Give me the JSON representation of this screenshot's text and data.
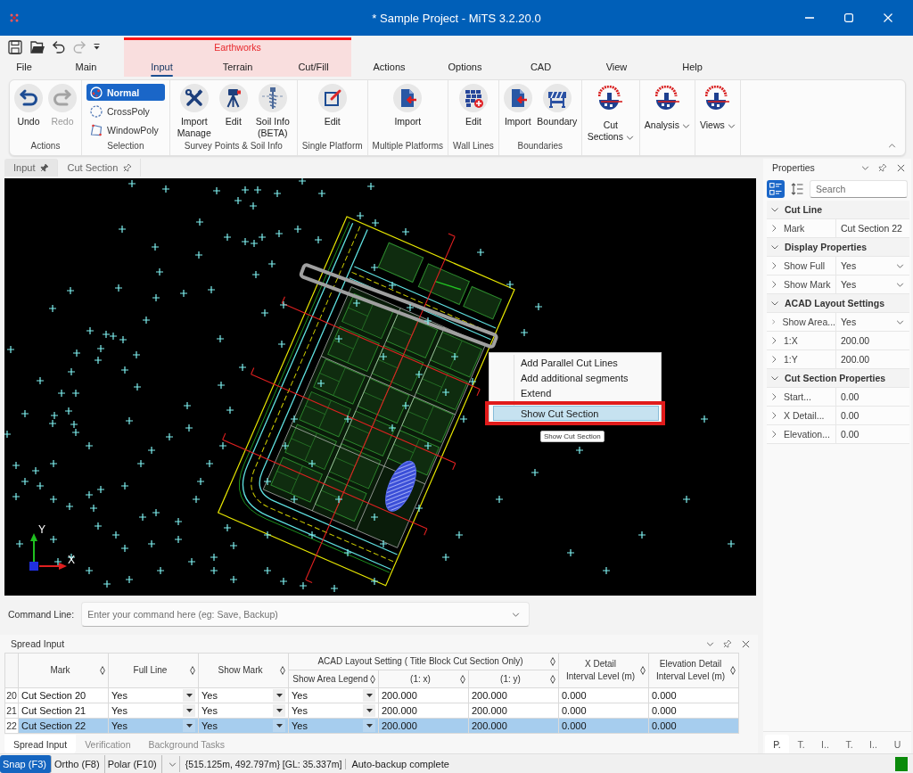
{
  "window": {
    "title": "* Sample Project - MiTS 3.2.20.0"
  },
  "quick_access": [
    {
      "kind": "save",
      "disabled": false
    },
    {
      "kind": "open",
      "disabled": false
    },
    {
      "kind": "undo",
      "disabled": false
    },
    {
      "kind": "redo",
      "disabled": true
    },
    {
      "kind": "customize",
      "disabled": false
    }
  ],
  "ribbon_tabs": [
    {
      "kind": "tab",
      "label": "File",
      "selected": false
    },
    {
      "kind": "tab",
      "label": "Main",
      "selected": false
    },
    {
      "kind": "context_group",
      "label": "Earthworks",
      "tabs": [
        {
          "label": "Input",
          "selected": true
        },
        {
          "label": "Terrain",
          "selected": false
        },
        {
          "label": "Cut/Fill",
          "selected": false
        }
      ]
    },
    {
      "kind": "tab",
      "label": "Actions",
      "selected": false
    },
    {
      "kind": "tab",
      "label": "Options",
      "selected": false
    },
    {
      "kind": "tab",
      "label": "CAD",
      "selected": false
    },
    {
      "kind": "tab",
      "label": "View",
      "selected": false
    },
    {
      "kind": "tab",
      "label": "Help",
      "selected": false
    }
  ],
  "ribbon_groups": [
    {
      "label": "Actions",
      "kind": "large",
      "buttons": [
        {
          "label": "Undo",
          "disabled": false
        },
        {
          "label": "Redo",
          "disabled": true
        }
      ]
    },
    {
      "label": "Selection",
      "kind": "options",
      "buttons": [
        {
          "label": "Normal",
          "selected": true
        },
        {
          "label": "CrossPoly",
          "selected": false
        },
        {
          "label": "WindowPoly",
          "selected": false
        }
      ]
    },
    {
      "label": "Survey Points & Soil Info",
      "kind": "large",
      "buttons": [
        {
          "label": "Import Manage",
          "disabled": false
        },
        {
          "label": "Edit",
          "disabled": false
        },
        {
          "label": "Soil Info (BETA)",
          "disabled": false
        }
      ]
    },
    {
      "label": "Single Platform",
      "kind": "large",
      "buttons": [
        {
          "label": "Edit",
          "disabled": false
        }
      ]
    },
    {
      "label": "Multiple Platforms",
      "kind": "large",
      "buttons": [
        {
          "label": "Import",
          "disabled": false
        }
      ]
    },
    {
      "label": "Wall Lines",
      "kind": "large",
      "buttons": [
        {
          "label": "Edit",
          "disabled": false
        }
      ]
    },
    {
      "label": "Boundaries",
      "kind": "large",
      "buttons": [
        {
          "label": "Import",
          "disabled": false
        },
        {
          "label": "Boundary",
          "disabled": false
        }
      ]
    },
    {
      "kind": "dropdown",
      "buttons": [
        {
          "label": "Cut Sections",
          "disabled": false
        }
      ]
    },
    {
      "kind": "dropdown",
      "buttons": [
        {
          "label": "Analysis",
          "disabled": false
        }
      ]
    },
    {
      "kind": "dropdown",
      "buttons": [
        {
          "label": "Views",
          "disabled": false
        }
      ]
    }
  ],
  "document_tabs": [
    {
      "label": "Input",
      "selected": true,
      "pinned": true
    },
    {
      "label": "Cut Section",
      "selected": false,
      "pinned": false
    }
  ],
  "canvas": {
    "axis": {
      "x_label": "X",
      "y_label": "Y"
    },
    "context_menu": [
      {
        "label": "Add Parallel Cut Lines",
        "selected": false,
        "annotated": false
      },
      {
        "label": "Add additional segments",
        "selected": false,
        "annotated": false
      },
      {
        "label": "Extend",
        "selected": false,
        "annotated": false
      },
      {
        "label": "Show Cut Section",
        "selected": true,
        "annotated": true
      }
    ],
    "tooltip": "Show Cut Section"
  },
  "command_line": {
    "label": "Command Line:",
    "placeholder": "Enter your command here (eg: Save, Backup)"
  },
  "spread_input": {
    "title": "Spread Input",
    "column_group": {
      "label": "ACAD Layout Setting ( Title Block Cut Section Only)"
    },
    "columns": [
      {
        "label": "Mark",
        "kind": "text",
        "grouped": false
      },
      {
        "label": "Full Line",
        "kind": "dropdown",
        "grouped": false
      },
      {
        "label": "Show Mark",
        "kind": "dropdown",
        "grouped": false
      },
      {
        "label": "Show Area Legend",
        "kind": "dropdown",
        "grouped": true
      },
      {
        "label": "(1: x)",
        "kind": "text",
        "grouped": true
      },
      {
        "label": "(1: y)",
        "kind": "text",
        "grouped": true
      },
      {
        "label": "X Detail\nInterval Level (m)",
        "kind": "text",
        "grouped": false
      },
      {
        "label": "Elevation Detail\nInterval Level (m)",
        "kind": "text",
        "grouped": false
      }
    ],
    "rows": [
      {
        "number": "20",
        "selected": false,
        "cells": [
          "Cut Section 20",
          "Yes",
          "Yes",
          "Yes",
          "200.000",
          "200.000",
          "0.000",
          "0.000"
        ]
      },
      {
        "number": "21",
        "selected": false,
        "cells": [
          "Cut Section 21",
          "Yes",
          "Yes",
          "Yes",
          "200.000",
          "200.000",
          "0.000",
          "0.000"
        ]
      },
      {
        "number": "22",
        "selected": true,
        "cells": [
          "Cut Section 22",
          "Yes",
          "Yes",
          "Yes",
          "200.000",
          "200.000",
          "0.000",
          "0.000"
        ]
      }
    ],
    "tabs": [
      {
        "label": "Spread Input",
        "selected": true
      },
      {
        "label": "Verification",
        "selected": false
      },
      {
        "label": "Background Tasks",
        "selected": false
      }
    ]
  },
  "properties": {
    "title": "Properties",
    "view_modes": [
      {
        "selected": true
      },
      {
        "selected": false
      }
    ],
    "search_placeholder": "Search",
    "categories": [
      {
        "label": "Cut Line",
        "expanded": true,
        "properties": [
          {
            "name": "Mark",
            "value": "Cut Section 22",
            "kind": "text",
            "expanded": false
          }
        ]
      },
      {
        "label": "Display Properties",
        "expanded": true,
        "properties": [
          {
            "name": "Show Full",
            "value": "Yes",
            "kind": "dropdown",
            "expanded": false
          },
          {
            "name": "Show Mark",
            "value": "Yes",
            "kind": "dropdown",
            "expanded": false
          }
        ]
      },
      {
        "label": "ACAD Layout Settings",
        "expanded": true,
        "properties": [
          {
            "name": "Show Area...",
            "value": "Yes",
            "kind": "dropdown",
            "expanded": false
          },
          {
            "name": "1:X",
            "value": "200.00",
            "kind": "text",
            "expanded": false
          },
          {
            "name": "1:Y",
            "value": "200.00",
            "kind": "text",
            "expanded": false
          }
        ]
      },
      {
        "label": "Cut Section Properties",
        "expanded": true,
        "properties": [
          {
            "name": "Start...",
            "value": "0.00",
            "kind": "text",
            "expanded": false
          },
          {
            "name": "X Detail...",
            "value": "0.00",
            "kind": "text",
            "expanded": false
          },
          {
            "name": "Elevation...",
            "value": "0.00",
            "kind": "text",
            "expanded": false
          }
        ]
      }
    ],
    "tabs": [
      {
        "label": "P.",
        "selected": true
      },
      {
        "label": "T.",
        "selected": false
      },
      {
        "label": "I..",
        "selected": false
      },
      {
        "label": "T.",
        "selected": false
      },
      {
        "label": "I..",
        "selected": false
      },
      {
        "label": "U",
        "selected": false
      }
    ]
  },
  "status_bar": {
    "toggles": [
      {
        "label": "Snap (F3)",
        "on": true
      },
      {
        "label": "Ortho (F8)",
        "on": false
      },
      {
        "label": "Polar (F10)",
        "on": false
      }
    ],
    "coordinates": "{515.125m, 492.797m} [GL: 35.337m]",
    "message": "Auto-backup complete"
  }
}
